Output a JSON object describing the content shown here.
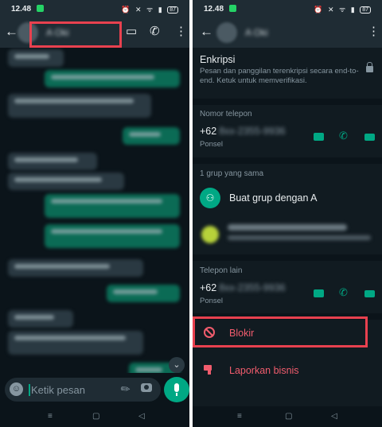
{
  "left": {
    "status": {
      "time": "12.48",
      "icons": "⏰ ✕ ᯤ ▮",
      "battery": "87"
    },
    "header": {
      "contact_name": "A Oki"
    },
    "input": {
      "placeholder": "Ketik pesan"
    },
    "scroll_down": "⌄"
  },
  "right": {
    "status": {
      "time": "12.48",
      "icons": "⏰ ✕ ᯤ ▮",
      "battery": "87"
    },
    "header": {
      "contact_name": "A Oki"
    },
    "encryption": {
      "title": "Enkripsi",
      "description": "Pesan dan panggilan terenkripsi secara end-to-end. Ketuk untuk memverifikasi."
    },
    "phone_section": {
      "title": "Nomor telepon",
      "number_prefix": "+62",
      "number_hidden": "8xx-2355-9936",
      "type": "Ponsel"
    },
    "groups_section": {
      "title": "1 grup yang sama",
      "create_group": "Buat grup dengan A"
    },
    "other_phone_section": {
      "title": "Telepon lain",
      "number_prefix": "+62",
      "number_hidden": "8xx-2355-9936",
      "type": "Ponsel"
    },
    "block_label": "Blokir",
    "report_label": "Laporkan bisnis"
  },
  "colors": {
    "accent": "#00a884",
    "danger": "#f15c6d",
    "highlight": "#e8414f",
    "background": "#111b21"
  }
}
